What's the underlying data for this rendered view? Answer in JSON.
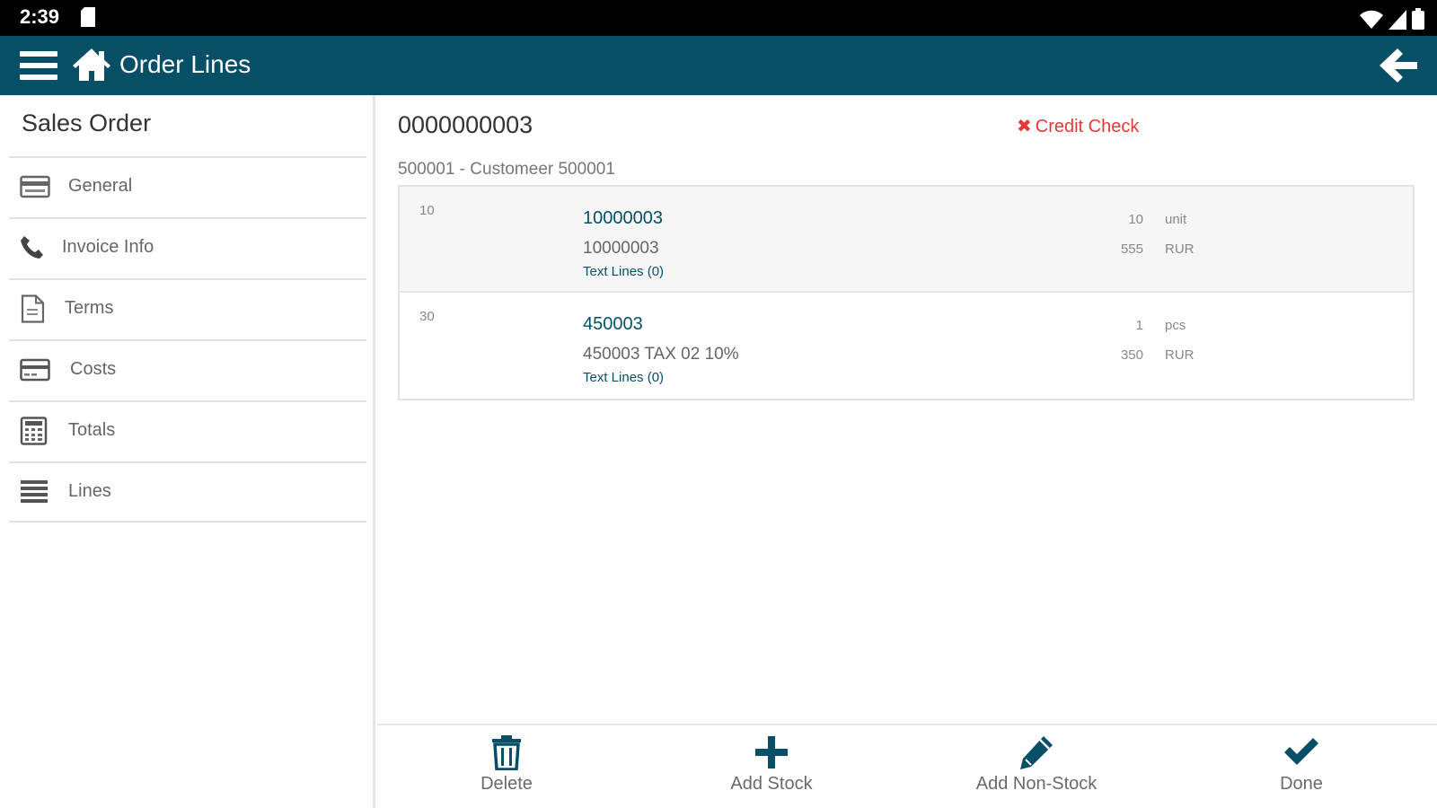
{
  "status_bar": {
    "time": "2:39"
  },
  "app_bar": {
    "title": "Order Lines"
  },
  "sidebar": {
    "title": "Sales Order",
    "items": [
      {
        "label": "General",
        "icon": "card-icon"
      },
      {
        "label": "Invoice Info",
        "icon": "phone-icon"
      },
      {
        "label": "Terms",
        "icon": "document-icon"
      },
      {
        "label": "Costs",
        "icon": "credit-card-icon"
      },
      {
        "label": "Totals",
        "icon": "calculator-icon"
      },
      {
        "label": "Lines",
        "icon": "list-lines-icon"
      }
    ]
  },
  "order": {
    "number": "0000000003",
    "credit_check": "Credit Check",
    "customer": "500001 - Customeer 500001"
  },
  "lines": [
    {
      "line_no": "10",
      "item_code": "10000003",
      "description": "10000003",
      "text_lines": "Text Lines (0)",
      "qty": "10",
      "unit": "unit",
      "price": "555",
      "currency": "RUR"
    },
    {
      "line_no": "30",
      "item_code": "450003",
      "description": "450003 TAX 02 10%",
      "text_lines": "Text Lines (0)",
      "qty": "1",
      "unit": "pcs",
      "price": "350",
      "currency": "RUR"
    }
  ],
  "actions": {
    "delete": "Delete",
    "add_stock": "Add Stock",
    "add_non_stock": "Add Non-Stock",
    "done": "Done"
  },
  "colors": {
    "app_bar": "#064f67",
    "accent": "#064f67",
    "error": "#e53935"
  }
}
